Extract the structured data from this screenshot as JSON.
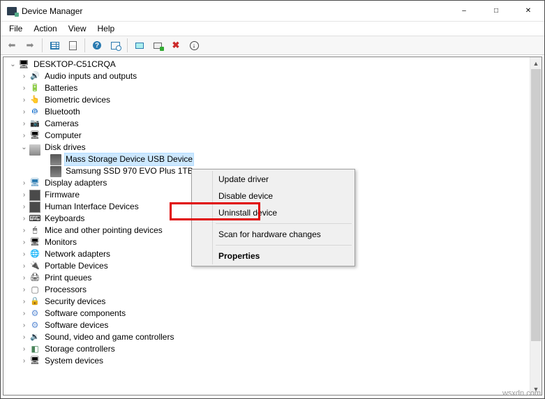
{
  "titlebar": {
    "title": "Device Manager"
  },
  "menubar": {
    "items": [
      "File",
      "Action",
      "View",
      "Help"
    ]
  },
  "tree": {
    "root": "DESKTOP-C51CRQA",
    "categories": [
      {
        "label": "Audio inputs and outputs",
        "icon": "ic-audio",
        "expanded": false
      },
      {
        "label": "Batteries",
        "icon": "ic-batt",
        "expanded": false
      },
      {
        "label": "Biometric devices",
        "icon": "ic-bio",
        "expanded": false
      },
      {
        "label": "Bluetooth",
        "icon": "ic-bt",
        "expanded": false
      },
      {
        "label": "Cameras",
        "icon": "ic-cam",
        "expanded": false
      },
      {
        "label": "Computer",
        "icon": "ic-comp",
        "expanded": false
      },
      {
        "label": "Disk drives",
        "icon": "ic-disk",
        "expanded": true,
        "children": [
          {
            "label": "Mass Storage Device USB Device",
            "icon": "ic-hdd",
            "selected": true
          },
          {
            "label": "Samsung SSD 970 EVO Plus 1TB",
            "icon": "ic-hdd"
          }
        ]
      },
      {
        "label": "Display adapters",
        "icon": "ic-disp",
        "expanded": false
      },
      {
        "label": "Firmware",
        "icon": "ic-chip",
        "expanded": false
      },
      {
        "label": "Human Interface Devices",
        "icon": "ic-chip",
        "expanded": false
      },
      {
        "label": "Keyboards",
        "icon": "ic-kb",
        "expanded": false
      },
      {
        "label": "Mice and other pointing devices",
        "icon": "ic-mouse",
        "expanded": false
      },
      {
        "label": "Monitors",
        "icon": "ic-mon",
        "expanded": false
      },
      {
        "label": "Network adapters",
        "icon": "ic-net",
        "expanded": false
      },
      {
        "label": "Portable Devices",
        "icon": "ic-port",
        "expanded": false
      },
      {
        "label": "Print queues",
        "icon": "ic-prn",
        "expanded": false
      },
      {
        "label": "Processors",
        "icon": "ic-cpu",
        "expanded": false
      },
      {
        "label": "Security devices",
        "icon": "ic-sec",
        "expanded": false
      },
      {
        "label": "Software components",
        "icon": "ic-gear",
        "expanded": false
      },
      {
        "label": "Software devices",
        "icon": "ic-gear",
        "expanded": false
      },
      {
        "label": "Sound, video and game controllers",
        "icon": "ic-snd",
        "expanded": false
      },
      {
        "label": "Storage controllers",
        "icon": "ic-stor",
        "expanded": false
      },
      {
        "label": "System devices",
        "icon": "ic-sys",
        "expanded": false
      }
    ]
  },
  "context_menu": {
    "items": [
      {
        "label": "Update driver"
      },
      {
        "label": "Disable device"
      },
      {
        "label": "Uninstall device",
        "highlighted": true
      },
      {
        "sep": true
      },
      {
        "label": "Scan for hardware changes"
      },
      {
        "sep": true
      },
      {
        "label": "Properties",
        "bold": true
      }
    ]
  },
  "watermark": "wsxdn.com"
}
